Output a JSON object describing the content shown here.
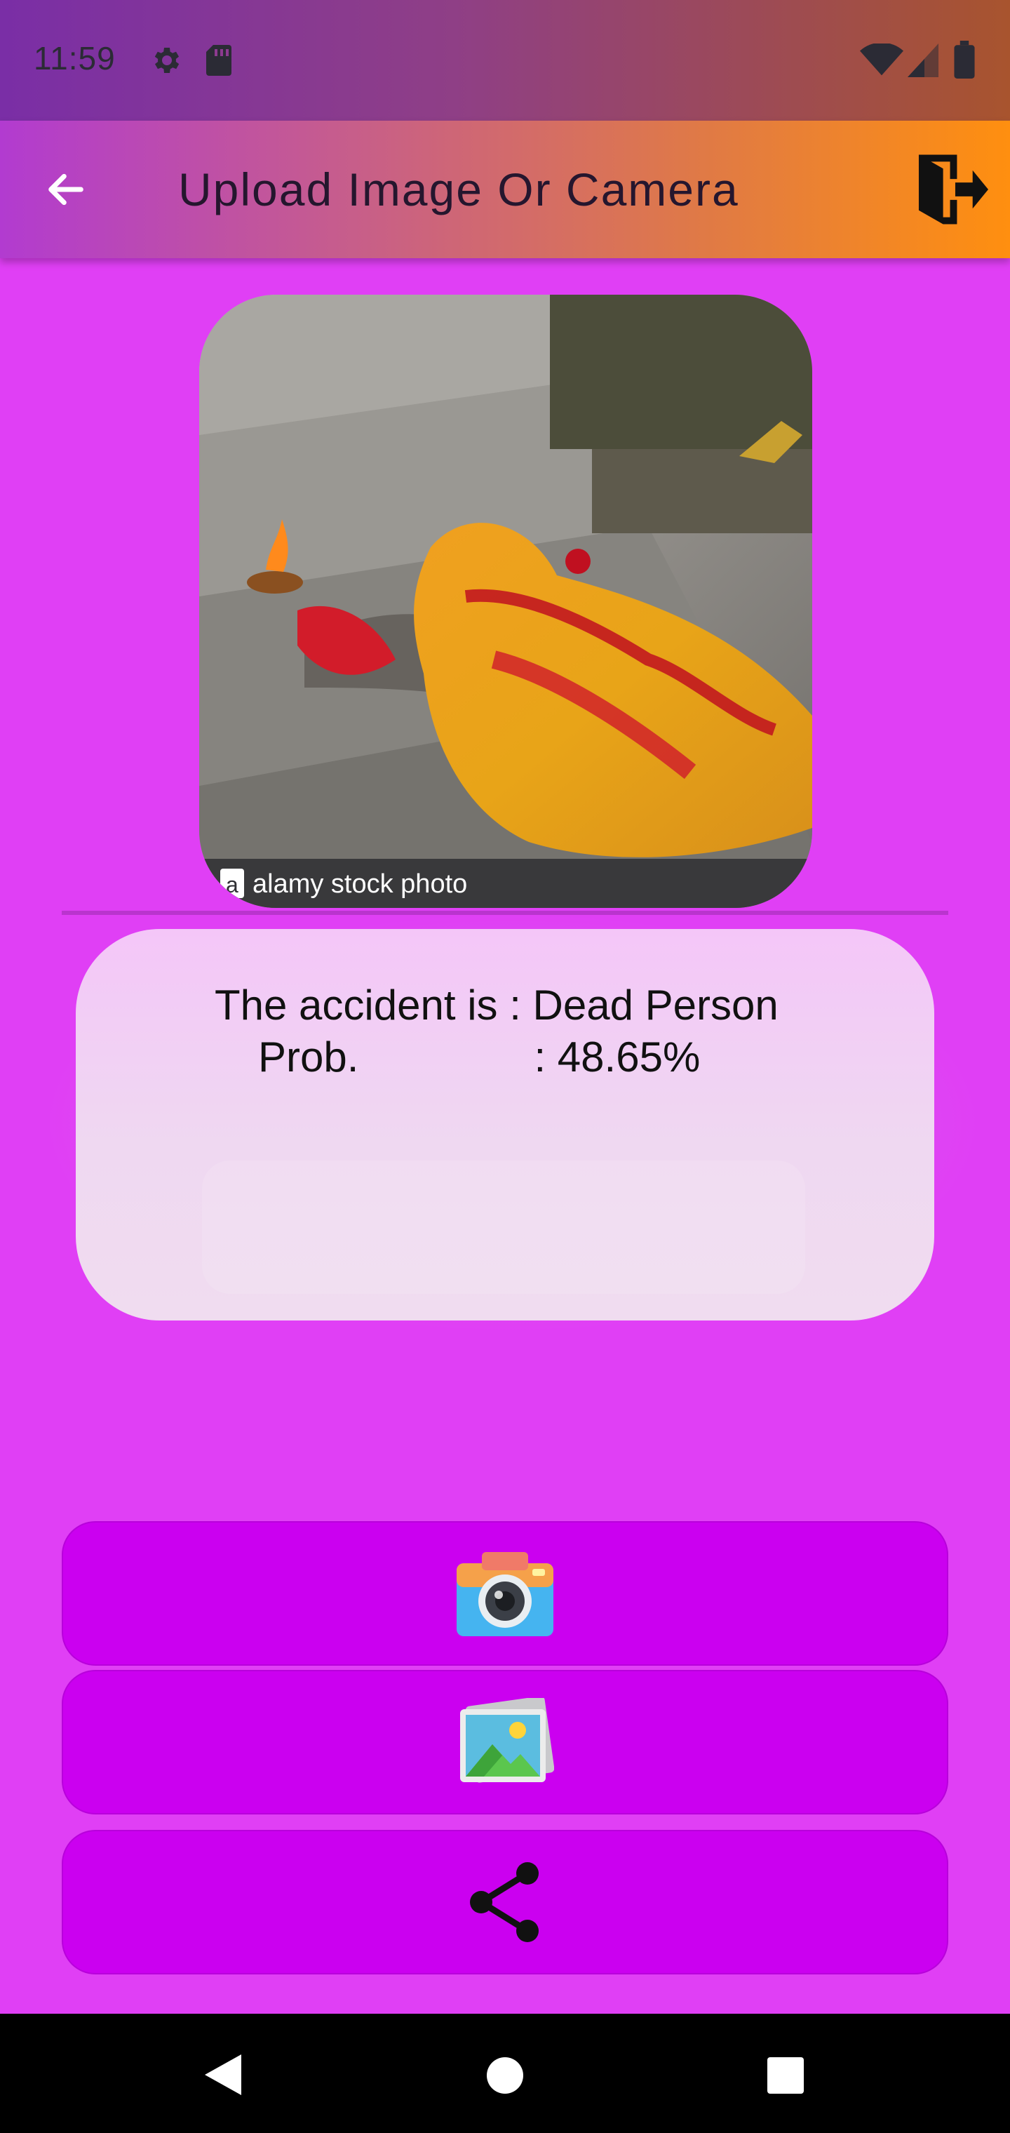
{
  "status_bar": {
    "time": "11:59"
  },
  "app_bar": {
    "title": "Upload Image Or Camera"
  },
  "photo": {
    "watermark_text": "alamy stock photo"
  },
  "result": {
    "line1": "The accident is : Dead Person",
    "line2": "Prob.               : 48.65%"
  },
  "buttons": [
    {
      "icon": "camera-icon"
    },
    {
      "icon": "gallery-icon"
    },
    {
      "icon": "share-icon"
    }
  ],
  "colors": {
    "background": "#e03ff5",
    "button": "#cb00f0",
    "appbar_start": "#b23bd0",
    "appbar_end": "#ff8f0f"
  }
}
